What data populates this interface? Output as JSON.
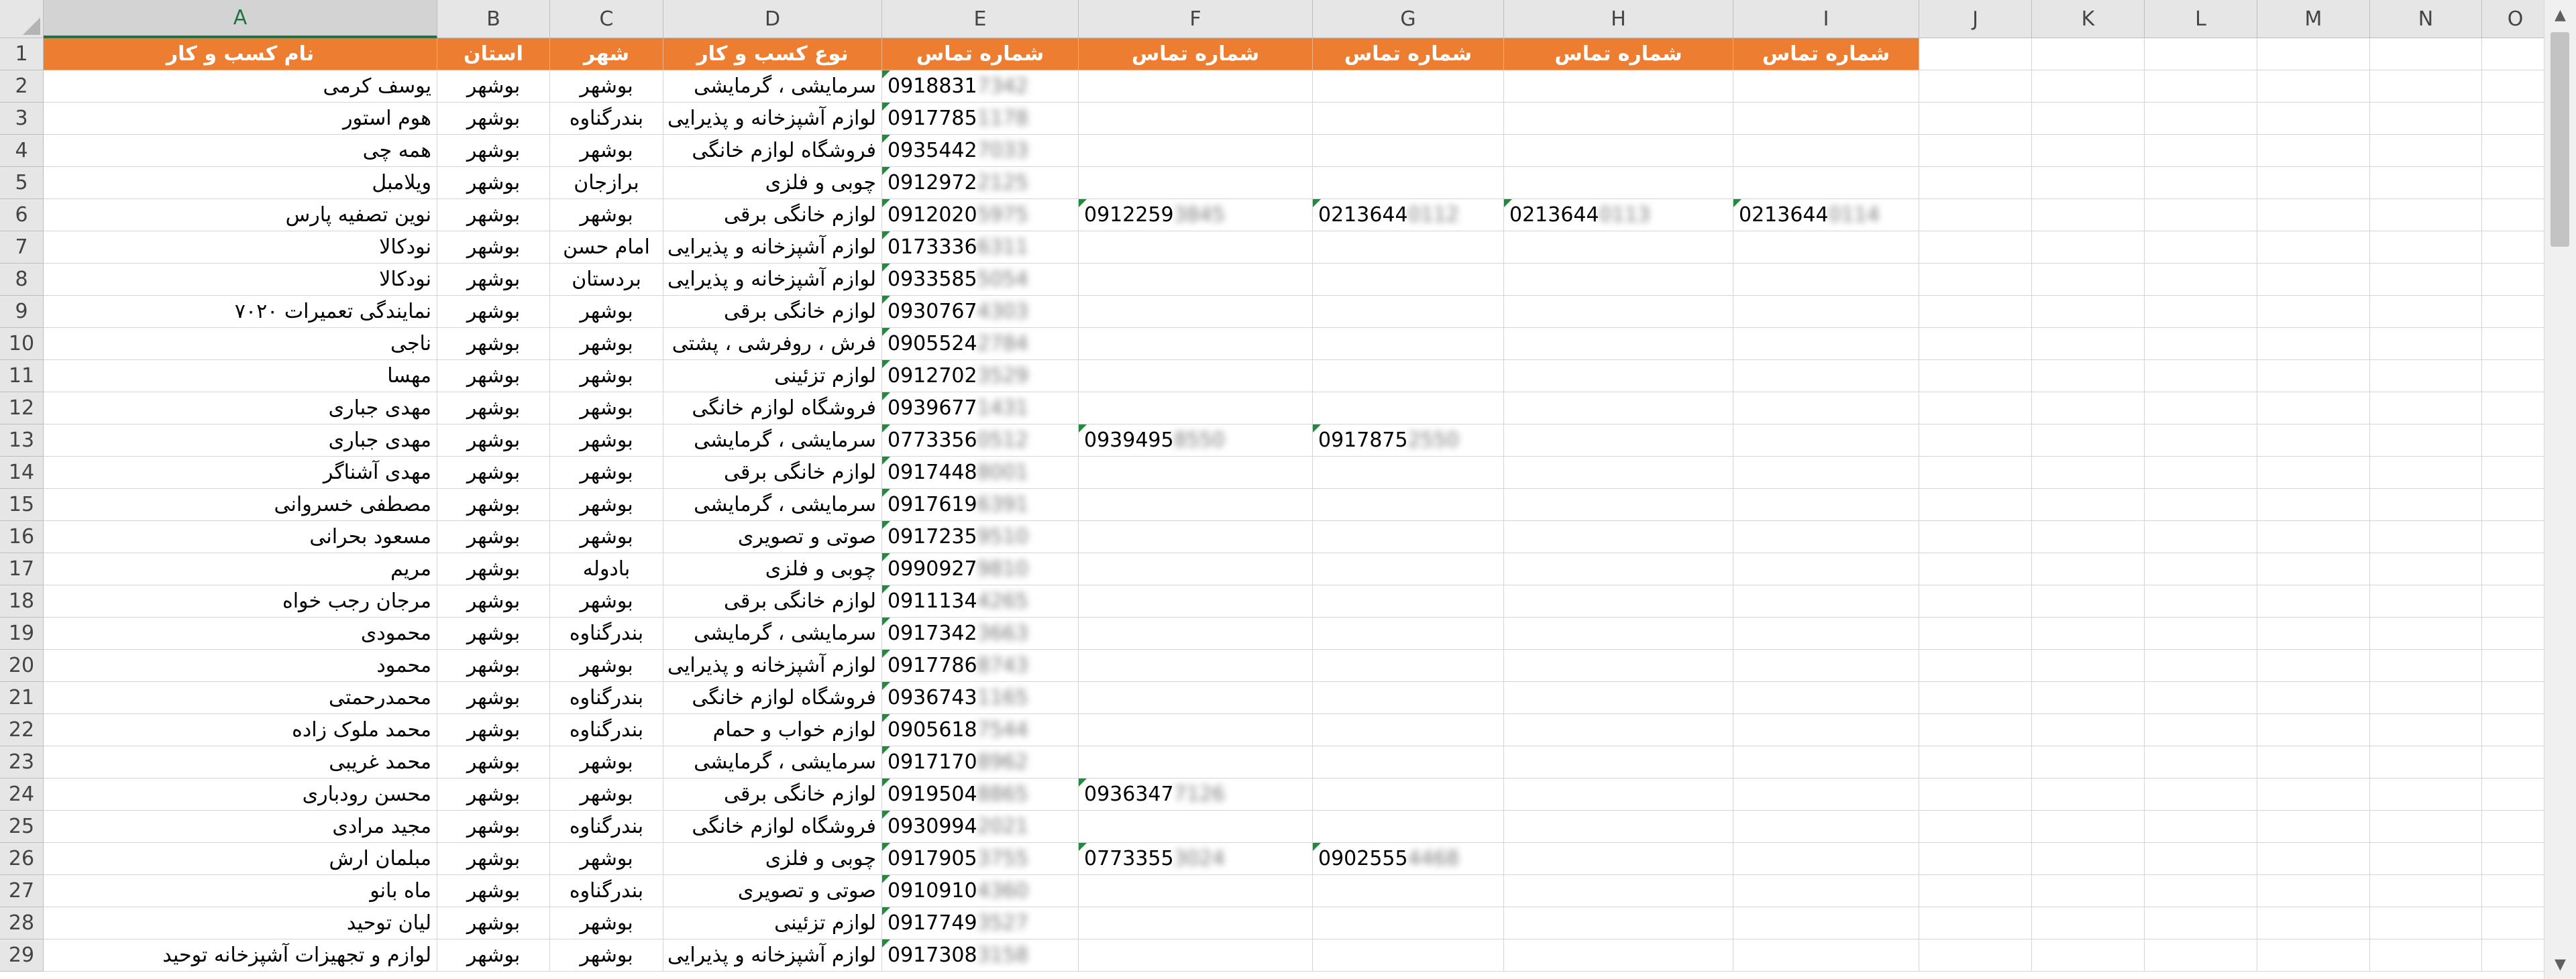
{
  "columns": [
    "A",
    "B",
    "C",
    "D",
    "E",
    "F",
    "G",
    "H",
    "I",
    "J",
    "K",
    "L",
    "M",
    "N",
    "O"
  ],
  "selected_column": "A",
  "header": [
    "نام کسب و کار",
    "استان",
    "شهر",
    "نوع کسب و کار",
    "شماره تماس",
    "شماره تماس",
    "شماره تماس",
    "شماره تماس",
    "شماره تماس"
  ],
  "rows": [
    {
      "n": "2",
      "name": "یوسف کرمی",
      "province": "بوشهر",
      "city": "بوشهر",
      "type": "سرمایشی ، گرمایشی",
      "phones": [
        {
          "v": "0918831",
          "h": "7342"
        }
      ]
    },
    {
      "n": "3",
      "name": "هوم استور",
      "province": "بوشهر",
      "city": "بندرگناوه",
      "type": "لوازم آشپزخانه و پذیرایی",
      "phones": [
        {
          "v": "0917785",
          "h": "1178"
        }
      ]
    },
    {
      "n": "4",
      "name": "همه چی",
      "province": "بوشهر",
      "city": "بوشهر",
      "type": "فروشگاه لوازم خانگی",
      "phones": [
        {
          "v": "0935442",
          "h": "7033"
        }
      ]
    },
    {
      "n": "5",
      "name": "ویلامبل",
      "province": "بوشهر",
      "city": "برازجان",
      "type": "چوبی و فلزی",
      "phones": [
        {
          "v": "0912972",
          "h": "2125"
        }
      ]
    },
    {
      "n": "6",
      "name": "نوین تصفیه پارس",
      "province": "بوشهر",
      "city": "بوشهر",
      "type": "لوازم خانگی برقی",
      "phones": [
        {
          "v": "0912020",
          "h": "5975"
        },
        {
          "v": "0912259",
          "h": "3845"
        },
        {
          "v": "0213644",
          "h": "0112"
        },
        {
          "v": "0213644",
          "h": "0113"
        },
        {
          "v": "0213644",
          "h": "0114"
        }
      ]
    },
    {
      "n": "7",
      "name": "نودکالا",
      "province": "بوشهر",
      "city": "امام حسن",
      "type": "لوازم آشپزخانه و پذیرایی",
      "phones": [
        {
          "v": "0173336",
          "h": "6311"
        }
      ]
    },
    {
      "n": "8",
      "name": "نودکالا",
      "province": "بوشهر",
      "city": "بردستان",
      "type": "لوازم آشپزخانه و پذیرایی",
      "phones": [
        {
          "v": "0933585",
          "h": "5054"
        }
      ]
    },
    {
      "n": "9",
      "name": "نمایندگی تعمیرات ۷۰۲۰",
      "province": "بوشهر",
      "city": "بوشهر",
      "type": "لوازم خانگی برقی",
      "phones": [
        {
          "v": "0930767",
          "h": "4303"
        }
      ]
    },
    {
      "n": "10",
      "name": "ناجی",
      "province": "بوشهر",
      "city": "بوشهر",
      "type": "فرش ، روفرشی ، پشتی",
      "phones": [
        {
          "v": "0905524",
          "h": "2784"
        }
      ]
    },
    {
      "n": "11",
      "name": "مهسا",
      "province": "بوشهر",
      "city": "بوشهر",
      "type": "لوازم تزئینی",
      "phones": [
        {
          "v": "0912702",
          "h": "3529"
        }
      ]
    },
    {
      "n": "12",
      "name": "مهدی جباری",
      "province": "بوشهر",
      "city": "بوشهر",
      "type": "فروشگاه لوازم خانگی",
      "phones": [
        {
          "v": "0939677",
          "h": "1431"
        }
      ]
    },
    {
      "n": "13",
      "name": "مهدی جباری",
      "province": "بوشهر",
      "city": "بوشهر",
      "type": "سرمایشی ، گرمایشی",
      "phones": [
        {
          "v": "0773356",
          "h": "0512"
        },
        {
          "v": "0939495",
          "h": "8550"
        },
        {
          "v": "0917875",
          "h": "2550"
        }
      ]
    },
    {
      "n": "14",
      "name": "مهدی آشناگر",
      "province": "بوشهر",
      "city": "بوشهر",
      "type": "لوازم خانگی برقی",
      "phones": [
        {
          "v": "0917448",
          "h": "8001"
        }
      ]
    },
    {
      "n": "15",
      "name": "مصطفی خسروانی",
      "province": "بوشهر",
      "city": "بوشهر",
      "type": "سرمایشی ، گرمایشی",
      "phones": [
        {
          "v": "0917619",
          "h": "6391"
        }
      ]
    },
    {
      "n": "16",
      "name": "مسعود بحرانی",
      "province": "بوشهر",
      "city": "بوشهر",
      "type": "صوتی و تصویری",
      "phones": [
        {
          "v": "0917235",
          "h": "9510"
        }
      ]
    },
    {
      "n": "17",
      "name": "مریم",
      "province": "بوشهر",
      "city": "بادوله",
      "type": "چوبی و فلزی",
      "phones": [
        {
          "v": "0990927",
          "h": "9810"
        }
      ]
    },
    {
      "n": "18",
      "name": "مرجان رجب خواه",
      "province": "بوشهر",
      "city": "بوشهر",
      "type": "لوازم خانگی برقی",
      "phones": [
        {
          "v": "0911134",
          "h": "4265"
        }
      ]
    },
    {
      "n": "19",
      "name": "محمودی",
      "province": "بوشهر",
      "city": "بندرگناوه",
      "type": "سرمایشی ، گرمایشی",
      "phones": [
        {
          "v": "0917342",
          "h": "3663"
        }
      ]
    },
    {
      "n": "20",
      "name": "محمود",
      "province": "بوشهر",
      "city": "بوشهر",
      "type": "لوازم آشپزخانه و پذیرایی",
      "phones": [
        {
          "v": "0917786",
          "h": "8743"
        }
      ]
    },
    {
      "n": "21",
      "name": "محمدرحمتی",
      "province": "بوشهر",
      "city": "بندرگناوه",
      "type": "فروشگاه لوازم خانگی",
      "phones": [
        {
          "v": "0936743",
          "h": "1165"
        }
      ]
    },
    {
      "n": "22",
      "name": "محمد ملوک زاده",
      "province": "بوشهر",
      "city": "بندرگناوه",
      "type": "لوازم خواب و حمام",
      "phones": [
        {
          "v": "0905618",
          "h": "7544"
        }
      ]
    },
    {
      "n": "23",
      "name": "محمد غریبی",
      "province": "بوشهر",
      "city": "بوشهر",
      "type": "سرمایشی ، گرمایشی",
      "phones": [
        {
          "v": "0917170",
          "h": "8962"
        }
      ]
    },
    {
      "n": "24",
      "name": "محسن رودباری",
      "province": "بوشهر",
      "city": "بوشهر",
      "type": "لوازم خانگی برقی",
      "phones": [
        {
          "v": "0919504",
          "h": "8865"
        },
        {
          "v": "0936347",
          "h": "7126"
        }
      ]
    },
    {
      "n": "25",
      "name": "مجید مرادی",
      "province": "بوشهر",
      "city": "بندرگناوه",
      "type": "فروشگاه لوازم خانگی",
      "phones": [
        {
          "v": "0930994",
          "h": "2021"
        }
      ]
    },
    {
      "n": "26",
      "name": "مبلمان ارش",
      "province": "بوشهر",
      "city": "بوشهر",
      "type": "چوبی و فلزی",
      "phones": [
        {
          "v": "0917905",
          "h": "3755"
        },
        {
          "v": "0773355",
          "h": "3024"
        },
        {
          "v": "0902555",
          "h": "4468"
        }
      ]
    },
    {
      "n": "27",
      "name": "ماه بانو",
      "province": "بوشهر",
      "city": "بندرگناوه",
      "type": "صوتی و تصویری",
      "phones": [
        {
          "v": "0910910",
          "h": "4360"
        }
      ]
    },
    {
      "n": "28",
      "name": "لیان توحید",
      "province": "بوشهر",
      "city": "بوشهر",
      "type": "لوازم تزئینی",
      "phones": [
        {
          "v": "0917749",
          "h": "3527"
        }
      ]
    },
    {
      "n": "29",
      "name": "لوازم و تجهیزات آشپزخانه توحید",
      "province": "بوشهر",
      "city": "بوشهر",
      "type": "لوازم آشپزخانه و پذیرایی",
      "phones": [
        {
          "v": "0917308",
          "h": "3158"
        }
      ]
    }
  ],
  "colors": {
    "header_fill": "#ed7d31",
    "header_text": "#ffffff",
    "selected_col": "#217346",
    "number_tag": "#1e8c3a"
  },
  "scrollbar": {
    "up_icon": "▲",
    "down_icon": "▼"
  }
}
